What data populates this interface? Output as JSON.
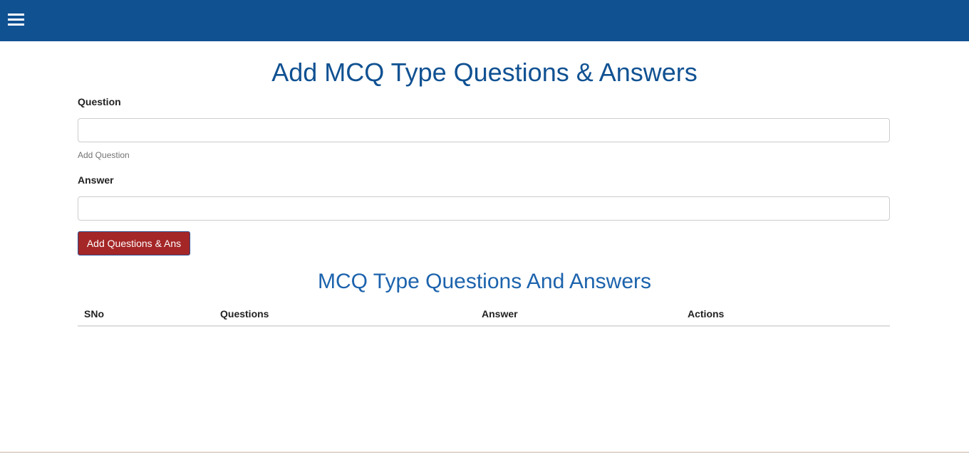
{
  "header": {
    "menu_icon": "hamburger-menu-icon",
    "bar_color": "#105192"
  },
  "form": {
    "title": "Add MCQ Type Questions & Answers",
    "question_label": "Question",
    "question_value": "",
    "question_help": "Add Question",
    "answer_label": "Answer",
    "answer_value": "",
    "submit_label": "Add Questions & Ans",
    "submit_color": "#a52626"
  },
  "list": {
    "title": "MCQ Type Questions And Answers",
    "columns": [
      "SNo",
      "Questions",
      "Answer",
      "Actions"
    ],
    "rows": []
  }
}
